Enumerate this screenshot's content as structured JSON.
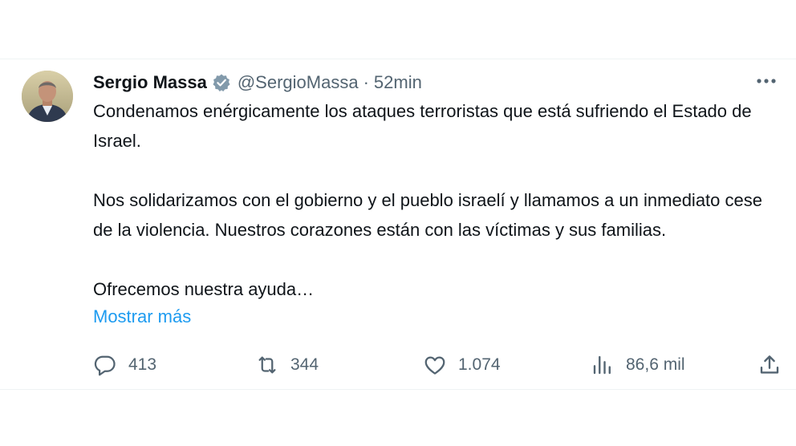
{
  "tweet": {
    "display_name": "Sergio Massa",
    "handle": "@SergioMassa",
    "separator": "·",
    "timestamp": "52min",
    "paragraphs": [
      "Condenamos enérgicamente los ataques terroristas que está sufriendo el Estado de Israel.",
      "Nos solidarizamos con el gobierno y el pueblo israelí y llamamos a un inmediato cese de la violencia. Nuestros corazones están con las víctimas y sus familias.",
      "Ofrecemos nuestra ayuda…"
    ],
    "show_more_label": "Mostrar más"
  },
  "actions": {
    "replies": "413",
    "reposts": "344",
    "likes": "1.074",
    "views": "86,6 mil"
  },
  "icons": {
    "verified": "verified-badge-icon",
    "more": "more-horizontal-icon",
    "reply": "reply-bubble-icon",
    "repost": "repost-arrows-icon",
    "like": "heart-icon",
    "views": "views-bars-icon",
    "share": "share-upload-icon"
  },
  "colors": {
    "text": "#0f1419",
    "secondary": "#536471",
    "link": "#1d9bf0",
    "verified": "#829aab"
  }
}
